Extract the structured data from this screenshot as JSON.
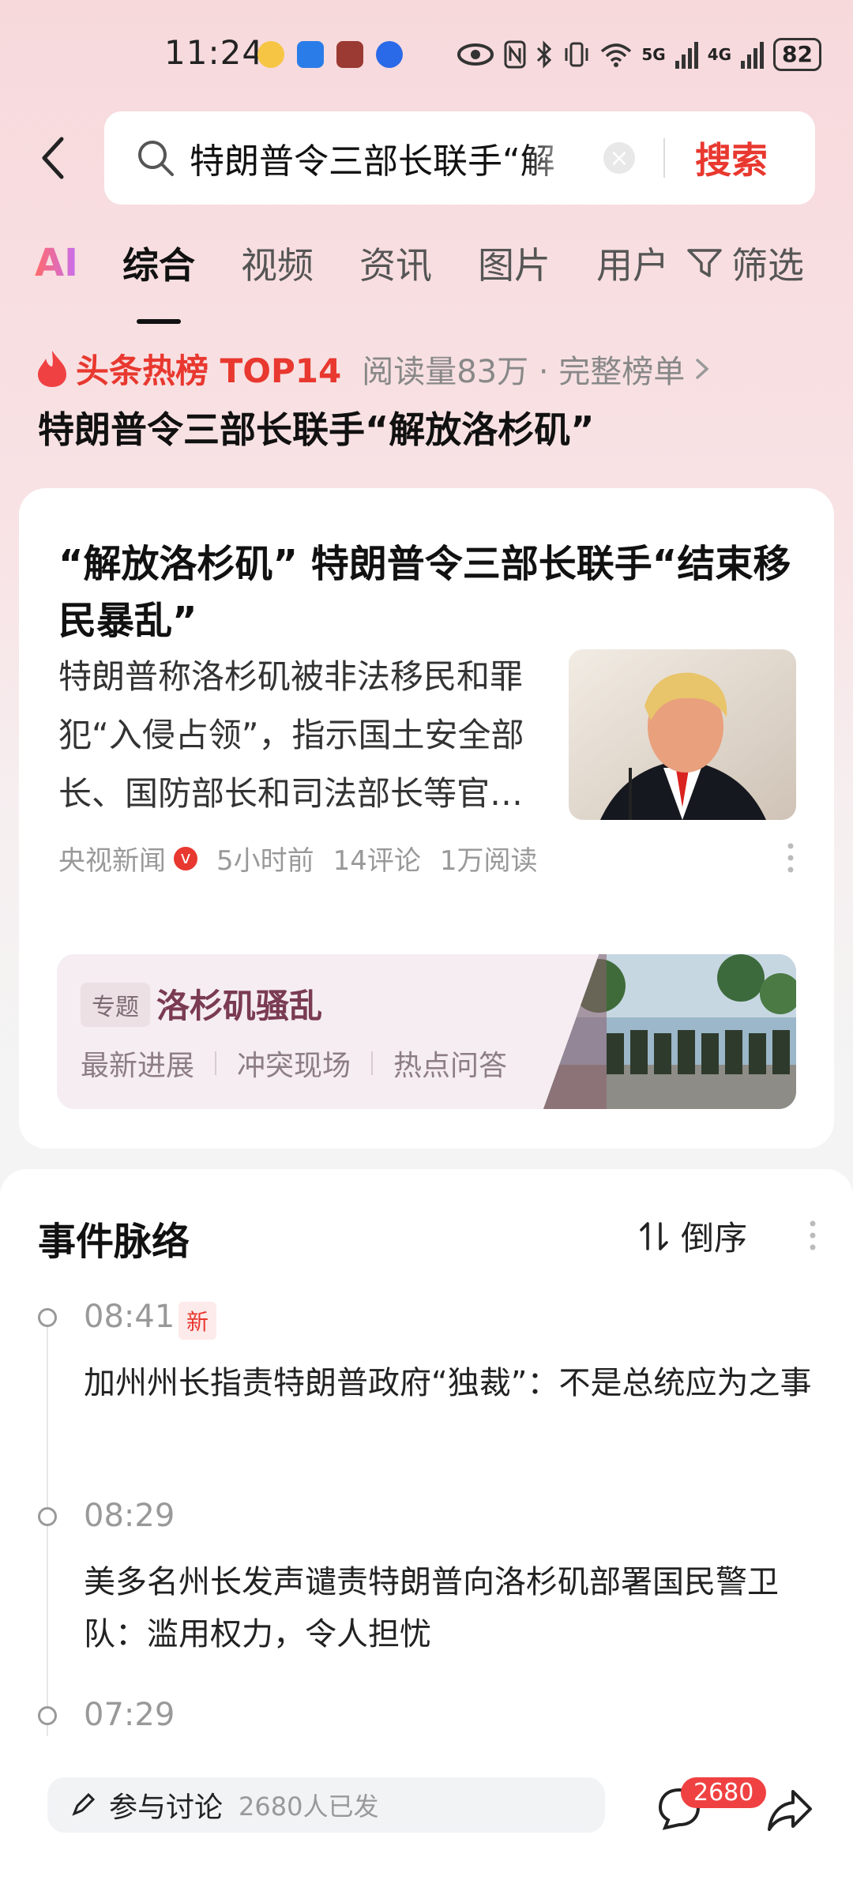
{
  "status_bar": {
    "time": "11:24",
    "battery": "82",
    "network_a": "5G",
    "network_b": "4G"
  },
  "search": {
    "query": "特朗普令三部长联手“解",
    "button": "搜索"
  },
  "tabs": {
    "ai": "AI",
    "items": [
      "综合",
      "视频",
      "资讯",
      "图片",
      "用户"
    ],
    "active": "综合",
    "filter": "筛选"
  },
  "hot_board": {
    "label": "头条热榜 TOP14",
    "meta": "阅读量83万 · 完整榜单",
    "title": "特朗普令三部长联手“解放洛杉矶”"
  },
  "article": {
    "title": "“解放洛杉矶” 特朗普令三部长联手“结束移民暴乱”",
    "summary": "特朗普称洛杉矶被非法移民和罪犯“入侵占领”，指示国土安全部长、国防部长和司法部长等官…",
    "source": "央视新闻",
    "verified": "v",
    "time": "5小时前",
    "comments": "14评论",
    "reads": "1万阅读"
  },
  "topic": {
    "tag": "专题",
    "title": "洛杉矶骚乱",
    "links": [
      "最新进展",
      "冲突现场",
      "热点问答"
    ]
  },
  "timeline": {
    "heading": "事件脉络",
    "sort": "倒序",
    "events": [
      {
        "time": "08:41",
        "badge": "新",
        "text": "加州州长指责特朗普政府“独裁”：不是总统应为之事"
      },
      {
        "time": "08:29",
        "text": "美多名州长发声谴责特朗普向洛杉矶部署国民警卫队：滥用权力，令人担忧"
      },
      {
        "time": "07:29"
      }
    ]
  },
  "bottom_bar": {
    "discuss": "参与讨论",
    "discuss_count": "2680人已发",
    "comment_count": "2680"
  },
  "colors": {
    "accent": "#e8382f",
    "topic_title": "#7a3b52",
    "background_top": "#f7d9dc"
  },
  "icons": [
    "back-arrow-icon",
    "search-icon",
    "clear-icon",
    "filter-icon",
    "fire-icon",
    "verified-icon",
    "more-icon",
    "sort-icon",
    "pen-icon",
    "comment-icon",
    "share-icon"
  ]
}
